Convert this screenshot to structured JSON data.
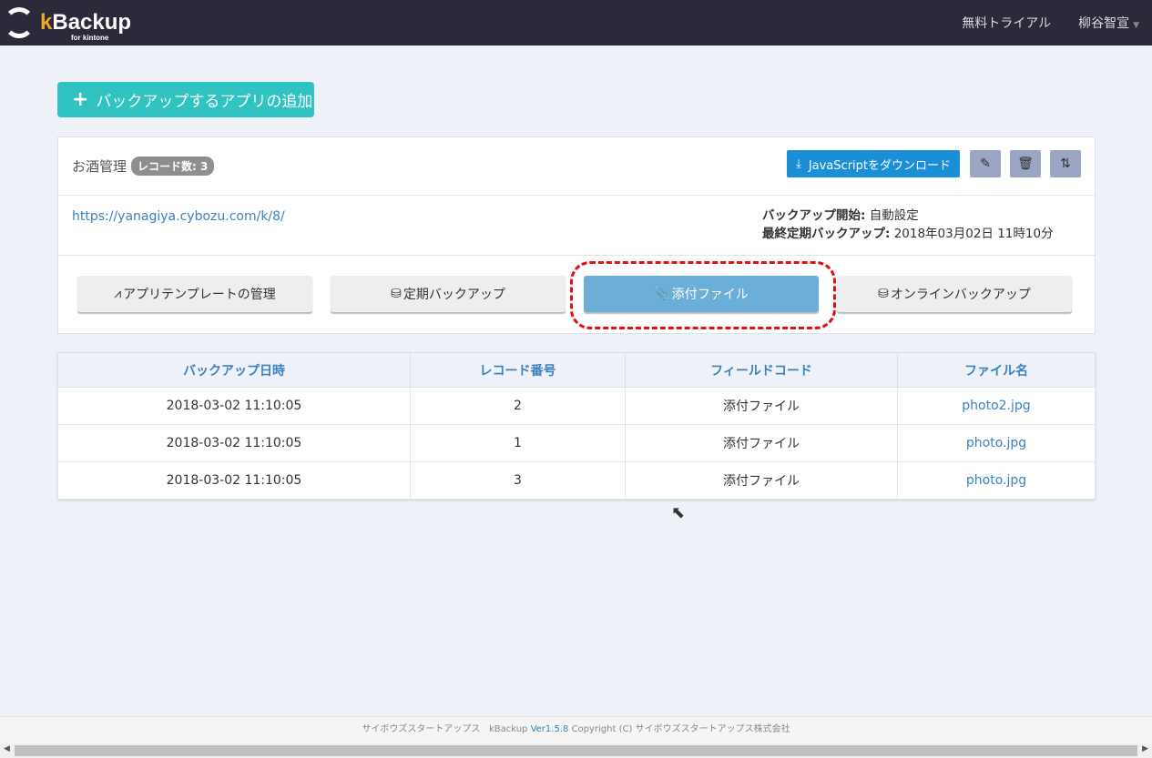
{
  "header": {
    "logo": "kBackup",
    "logo_k": "k",
    "logo_rest": "Backup",
    "logo_sub": "for kintone",
    "trial": "無料トライアル",
    "user": "柳谷智宣"
  },
  "add_button": "バックアップするアプリの追加",
  "app": {
    "name": "お酒管理",
    "badge": "レコード数: 3",
    "download": "JavaScriptをダウンロード",
    "url": "https://yanagiya.cybozu.com/k/8/",
    "start_label": "バックアップ開始:",
    "start_value": "自動設定",
    "last_label": "最終定期バックアップ:",
    "last_value": "2018年03月02日 11時10分"
  },
  "tabs": [
    {
      "label": "アプリテンプレートの管理",
      "icon": "app-store-icon"
    },
    {
      "label": "定期バックアップ",
      "icon": "database-clock-icon"
    },
    {
      "label": "添付ファイル",
      "icon": "paperclip-icon",
      "active": true
    },
    {
      "label": "オンラインバックアップ",
      "icon": "database-arrow-icon"
    }
  ],
  "table": {
    "headers": [
      "バックアップ日時",
      "レコード番号",
      "フィールドコード",
      "ファイル名"
    ],
    "rows": [
      [
        "2018-03-02 11:10:05",
        "2",
        "添付ファイル",
        "photo2.jpg"
      ],
      [
        "2018-03-02 11:10:05",
        "1",
        "添付ファイル",
        "photo.jpg"
      ],
      [
        "2018-03-02 11:10:05",
        "3",
        "添付ファイル",
        "photo.jpg"
      ]
    ]
  },
  "footer": {
    "company": "サイボウズスタートアップス",
    "product": "kBackup",
    "version": "Ver1.5.8",
    "copyright": "Copyright (C) サイボウズスタートアップス株式会社"
  }
}
